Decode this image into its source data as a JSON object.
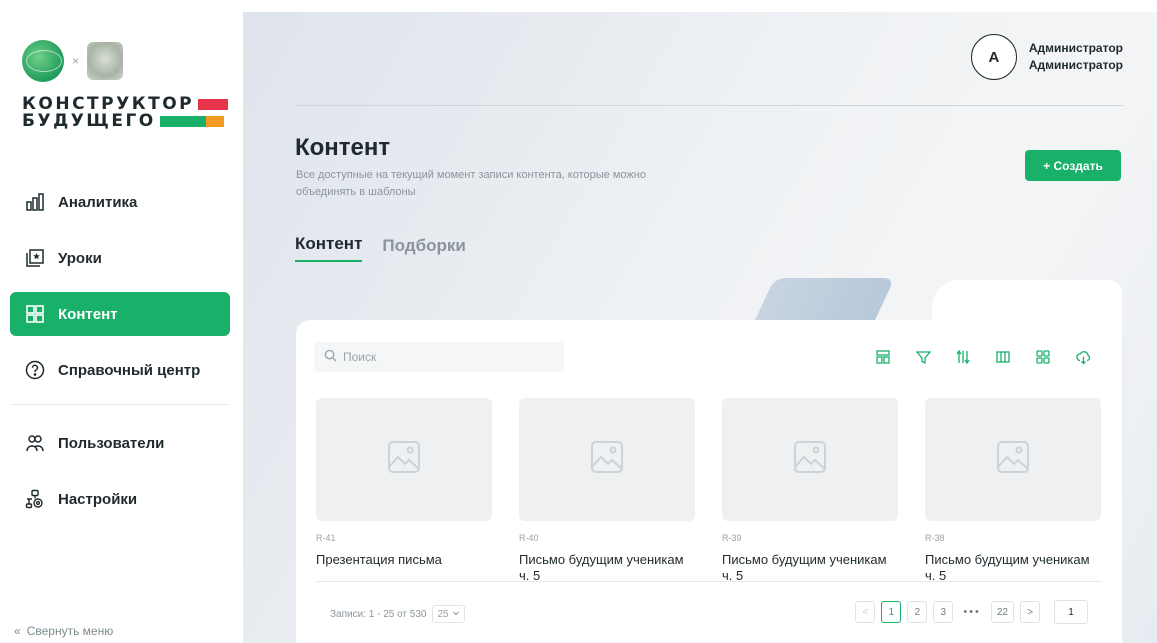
{
  "brand": {
    "line1": "КОНСТРУКТОР",
    "line2": "БУДУЩЕГО",
    "separator": "×",
    "colors": {
      "red": "#e8344a",
      "green": "#19b06a",
      "orange": "#f39a23"
    }
  },
  "sidebar": {
    "items": [
      {
        "label": "Аналитика",
        "icon": "chart-icon",
        "active": false
      },
      {
        "label": "Уроки",
        "icon": "lessons-icon",
        "active": false
      },
      {
        "label": "Контент",
        "icon": "content-grid-icon",
        "active": true
      },
      {
        "label": "Справочный центр",
        "icon": "help-icon",
        "active": false
      },
      {
        "label": "Пользователи",
        "icon": "users-icon",
        "active": false
      },
      {
        "label": "Настройки",
        "icon": "settings-icon",
        "active": false
      }
    ],
    "collapse_label": "Свернуть меню",
    "collapse_icon": "«"
  },
  "user": {
    "avatar_letter": "А",
    "name_line1": "Администратор",
    "name_line2": "Администратор"
  },
  "page": {
    "title": "Контент",
    "subtitle": "Все доступные на текущий момент записи контента, которые можно объединять в шаблоны",
    "create_label": "+ Создать"
  },
  "tabs": [
    {
      "label": "Контент",
      "active": true
    },
    {
      "label": "Подборки",
      "active": false
    }
  ],
  "search": {
    "placeholder": "Поиск"
  },
  "toolbar": [
    "table-view-icon",
    "filter-icon",
    "sort-icon",
    "columns-icon",
    "grid-view-icon",
    "download-icon"
  ],
  "items": [
    {
      "id": "R-41",
      "title": "Презентация письма"
    },
    {
      "id": "R-40",
      "title": "Письмо будущим ученикам ч. 5"
    },
    {
      "id": "R-39",
      "title": "Письмо будущим ученикам ч. 5"
    },
    {
      "id": "R-38",
      "title": "Письмо будущим ученикам ч. 5"
    }
  ],
  "pagination": {
    "records_text": "Записи: 1 - 25 от 530",
    "per_page": "25",
    "pages": [
      "1",
      "2",
      "3"
    ],
    "dots": "•••",
    "last_page": "22",
    "current": "1",
    "jump_value": "1",
    "prev": "<",
    "next": ">"
  },
  "colors": {
    "accent": "#19b06a",
    "text": "#1f2a2e",
    "muted": "#8a959b"
  }
}
